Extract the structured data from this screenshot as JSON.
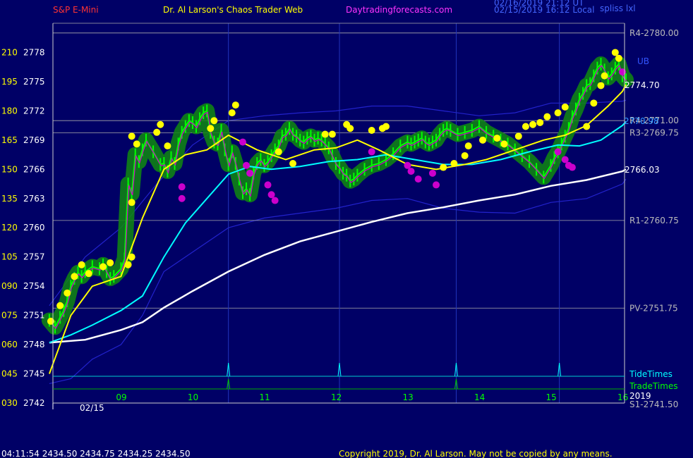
{
  "header": {
    "instrument": "S&P E-Mini",
    "site_title": "Dr. Al Larson's Chaos Trader Web",
    "site_url": "Daytradingforecasts.com",
    "timestamp_line1": "02/16/2019 21:12 UT",
    "timestamp_line2": "02/15/2019 16:12 Local",
    "corner_label": "spliss lxl"
  },
  "footer": {
    "last_bar": "04:11:54  2434.50  2434.75  2434.25  2434.50",
    "copyright": "Copyright 2019, Dr. Al Larson. May not be copied by any means."
  },
  "colors": {
    "background": "#000066",
    "price_line": "#00ff00",
    "short_average": "#ffff00",
    "mid_average": "#00ffff",
    "long_average": "#ffffff",
    "band": "#2222cc",
    "highs": "#ffff00",
    "lows": "#cc00cc",
    "level_lines": "#aaaaaa",
    "tide_times": "#00ffff",
    "trade_times": "#00cc00"
  },
  "chart_data": {
    "type": "line",
    "ylim": [
      2742,
      2781
    ],
    "xlim": [
      8.0,
      16.05
    ],
    "y_ticks": [
      {
        "price": 2778,
        "label": "210",
        "value": "2778"
      },
      {
        "price": 2775,
        "label": "195",
        "value": "2775"
      },
      {
        "price": 2772,
        "label": "180",
        "value": "2772"
      },
      {
        "price": 2769,
        "label": "165",
        "value": "2769"
      },
      {
        "price": 2766,
        "label": "150",
        "value": "2766"
      },
      {
        "price": 2763,
        "label": "135",
        "value": "2763"
      },
      {
        "price": 2760,
        "label": "120",
        "value": "2760"
      },
      {
        "price": 2757,
        "label": "105",
        "value": "2757"
      },
      {
        "price": 2754,
        "label": "090",
        "value": "2754"
      },
      {
        "price": 2751,
        "label": "075",
        "value": "2751"
      },
      {
        "price": 2748,
        "label": "060",
        "value": "2748"
      },
      {
        "price": 2745,
        "label": "045",
        "value": "2745"
      },
      {
        "price": 2742,
        "label": "030",
        "value": "2742"
      }
    ],
    "x_ticks": [
      {
        "hour": 9,
        "label": "09"
      },
      {
        "hour": 10,
        "label": "10"
      },
      {
        "hour": 11,
        "label": "11"
      },
      {
        "hour": 12,
        "label": "12"
      },
      {
        "hour": 13,
        "label": "13"
      },
      {
        "hour": 14,
        "label": "14"
      },
      {
        "hour": 15,
        "label": "15"
      },
      {
        "hour": 16,
        "label": "16"
      }
    ],
    "date_label": "02/15",
    "levels": [
      {
        "price": 2780.0,
        "label": "R4-2780.00"
      },
      {
        "price": 2771.0,
        "label": "R4-2771.00"
      },
      {
        "price": 2769.75,
        "label": "R3-2769.75"
      },
      {
        "price": 2760.75,
        "label": "R1-2760.75"
      },
      {
        "price": 2751.75,
        "label": "PV-2751.75"
      },
      {
        "price": 2741.5,
        "label": "S1-2741.50"
      }
    ],
    "level_extra_labels": [
      "UB",
      "2770.98"
    ],
    "value_labels": [
      {
        "price": 2774.7,
        "label": "2774.70"
      },
      {
        "price": 2766.03,
        "label": "2766.03"
      }
    ],
    "vertical_lines": [
      10.5,
      12.05,
      13.68,
      15.12
    ],
    "tide_times": [
      10.5,
      12.05,
      13.68,
      15.12
    ],
    "trade_times": [
      10.5,
      13.68
    ],
    "tide_label": "TideTimes",
    "trade_label": "TradeTimes",
    "year_label": "2019",
    "series": [
      {
        "role": "price",
        "x": [
          8.0,
          8.08,
          8.15,
          8.2,
          8.25,
          8.3,
          8.35,
          8.4,
          8.45,
          8.5,
          8.6,
          8.7,
          8.75,
          8.8,
          8.85,
          8.9,
          9.0,
          9.05,
          9.1,
          9.15,
          9.2,
          9.25,
          9.3,
          9.35,
          9.45,
          9.55,
          9.6,
          9.65,
          9.7,
          9.75,
          9.8,
          9.85,
          9.9,
          9.95,
          10.0,
          10.05,
          10.1,
          10.15,
          10.2,
          10.25,
          10.3,
          10.35,
          10.4,
          10.45,
          10.5,
          10.55,
          10.6,
          10.65,
          10.7,
          10.75,
          10.8,
          10.85,
          10.9,
          10.95,
          11.0,
          11.05,
          11.1,
          11.15,
          11.2,
          11.25,
          11.3,
          11.35,
          11.4,
          11.45,
          11.5,
          11.55,
          11.6,
          11.65,
          11.7,
          11.75,
          11.8,
          11.85,
          11.9,
          11.95,
          12.0,
          12.05,
          12.1,
          12.15,
          12.2,
          12.25,
          12.3,
          12.4,
          12.5,
          12.6,
          12.7,
          12.8,
          12.9,
          13.0,
          13.05,
          13.1,
          13.15,
          13.2,
          13.25,
          13.3,
          13.35,
          13.4,
          13.45,
          13.5,
          13.55,
          13.6,
          13.7,
          13.8,
          13.9,
          14.0,
          14.1,
          14.2,
          14.3,
          14.4,
          14.5,
          14.6,
          14.7,
          14.8,
          14.9,
          15.0,
          15.05,
          15.1,
          15.15,
          15.2,
          15.25,
          15.3,
          15.35,
          15.4,
          15.45,
          15.5,
          15.55,
          15.6,
          15.65,
          15.7,
          15.75,
          15.8,
          15.85,
          15.9,
          15.95,
          16.0,
          16.05
        ],
        "values": [
          2750.5,
          2749.8,
          2750.8,
          2751.5,
          2752.5,
          2754.0,
          2754.8,
          2755.4,
          2755.0,
          2755.5,
          2756.0,
          2755.8,
          2756.2,
          2755.5,
          2754.8,
          2755.0,
          2755.8,
          2756.8,
          2764.5,
          2763.5,
          2767.5,
          2766.8,
          2768.0,
          2769.0,
          2767.8,
          2766.5,
          2766.6,
          2765.8,
          2767.2,
          2766.6,
          2768.6,
          2769.8,
          2770.4,
          2771.0,
          2770.8,
          2770.4,
          2771.2,
          2771.8,
          2772.0,
          2769.8,
          2768.8,
          2768.6,
          2770.0,
          2768.0,
          2766.5,
          2767.8,
          2766.6,
          2765.0,
          2763.6,
          2764.0,
          2763.4,
          2765.6,
          2766.6,
          2767.0,
          2766.4,
          2766.8,
          2767.4,
          2768.0,
          2768.4,
          2769.4,
          2769.6,
          2770.2,
          2769.6,
          2769.4,
          2769.0,
          2768.8,
          2769.2,
          2769.4,
          2769.0,
          2769.2,
          2769.0,
          2768.6,
          2768.2,
          2767.4,
          2766.6,
          2766.2,
          2765.6,
          2765.4,
          2764.8,
          2765.0,
          2765.4,
          2766.0,
          2766.4,
          2766.6,
          2767.0,
          2767.6,
          2768.4,
          2768.8,
          2768.6,
          2768.8,
          2769.0,
          2769.2,
          2768.8,
          2768.6,
          2768.8,
          2769.0,
          2769.6,
          2770.0,
          2770.2,
          2770.0,
          2769.6,
          2769.8,
          2770.0,
          2770.4,
          2769.8,
          2769.4,
          2769.0,
          2768.6,
          2768.0,
          2767.4,
          2766.8,
          2766.0,
          2765.2,
          2766.4,
          2767.2,
          2767.8,
          2768.6,
          2769.4,
          2770.2,
          2771.4,
          2772.2,
          2773.2,
          2773.8,
          2774.6,
          2774.8,
          2775.6,
          2776.4,
          2776.8,
          2776.2,
          2775.4,
          2775.8,
          2776.4,
          2776.8,
          2775.6,
          2775.2
        ]
      },
      {
        "role": "short_average",
        "x": [
          8.0,
          8.3,
          8.6,
          9.0,
          9.3,
          9.6,
          9.9,
          10.2,
          10.5,
          10.9,
          11.3,
          11.7,
          12.0,
          12.3,
          12.6,
          13.0,
          13.4,
          13.8,
          14.1,
          14.5,
          14.9,
          15.2,
          15.5,
          15.8,
          16.0,
          16.05
        ],
        "values": [
          2745.0,
          2751.0,
          2754.0,
          2755.0,
          2761.0,
          2766.0,
          2767.5,
          2768.0,
          2769.5,
          2768.0,
          2767.0,
          2768.0,
          2768.2,
          2769.0,
          2768.0,
          2766.5,
          2766.0,
          2766.5,
          2767.0,
          2768.0,
          2769.0,
          2769.5,
          2770.5,
          2772.5,
          2774.0,
          2774.7
        ]
      },
      {
        "role": "mid_average",
        "x": [
          8.0,
          8.3,
          8.6,
          9.0,
          9.3,
          9.6,
          9.9,
          10.2,
          10.5,
          10.8,
          11.1,
          11.5,
          11.9,
          12.3,
          12.7,
          13.1,
          13.5,
          13.9,
          14.3,
          14.7,
          15.1,
          15.4,
          15.7,
          16.0,
          16.05
        ],
        "values": [
          2748.2,
          2749.0,
          2750.0,
          2751.5,
          2753.0,
          2757.0,
          2760.5,
          2763.0,
          2765.5,
          2766.3,
          2766.0,
          2766.3,
          2766.8,
          2767.0,
          2767.5,
          2767.0,
          2766.5,
          2766.5,
          2767.0,
          2767.8,
          2768.5,
          2768.4,
          2769.0,
          2770.5,
          2770.9
        ]
      },
      {
        "role": "long_average",
        "x": [
          8.0,
          8.5,
          9.0,
          9.3,
          9.6,
          10.0,
          10.5,
          11.0,
          11.5,
          12.0,
          12.5,
          13.0,
          13.5,
          14.0,
          14.5,
          15.0,
          15.5,
          16.0,
          16.05
        ],
        "values": [
          2748.2,
          2748.5,
          2749.5,
          2750.3,
          2751.8,
          2753.5,
          2755.5,
          2757.2,
          2758.6,
          2759.6,
          2760.6,
          2761.5,
          2762.1,
          2762.8,
          2763.4,
          2764.3,
          2764.9,
          2765.8,
          2766.0
        ]
      },
      {
        "role": "upper_band",
        "x": [
          8.0,
          8.5,
          9.0,
          9.5,
          10.0,
          10.5,
          11.0,
          11.5,
          12.0,
          12.5,
          13.0,
          13.5,
          14.0,
          14.5,
          15.0,
          15.5,
          16.0,
          16.05
        ],
        "values": [
          2752.0,
          2757.0,
          2760.0,
          2764.5,
          2768.5,
          2771.0,
          2771.5,
          2771.8,
          2772.0,
          2772.5,
          2772.5,
          2772.0,
          2771.5,
          2771.8,
          2772.8,
          2772.8,
          2773.0,
          2773.1
        ]
      },
      {
        "role": "lower_band",
        "x": [
          8.0,
          8.3,
          8.6,
          9.0,
          9.3,
          9.6,
          10.0,
          10.5,
          11.0,
          11.5,
          12.0,
          12.5,
          13.0,
          13.5,
          14.0,
          14.5,
          15.0,
          15.5,
          16.0,
          16.05
        ],
        "values": [
          2744.0,
          2744.5,
          2746.5,
          2748.0,
          2751.0,
          2755.5,
          2757.5,
          2760.0,
          2761.0,
          2761.5,
          2762.0,
          2762.8,
          2763.0,
          2762.0,
          2761.6,
          2761.5,
          2762.6,
          2763.0,
          2764.5,
          2765.0
        ]
      }
    ],
    "highs": [
      {
        "x": 8.02,
        "price": 2750.4
      },
      {
        "x": 8.15,
        "price": 2752.0
      },
      {
        "x": 8.25,
        "price": 2753.3
      },
      {
        "x": 8.35,
        "price": 2755.0
      },
      {
        "x": 8.45,
        "price": 2756.2
      },
      {
        "x": 8.55,
        "price": 2755.3
      },
      {
        "x": 8.75,
        "price": 2756.0
      },
      {
        "x": 8.85,
        "price": 2756.4
      },
      {
        "x": 9.1,
        "price": 2756.2
      },
      {
        "x": 9.15,
        "price": 2769.4
      },
      {
        "x": 9.22,
        "price": 2768.6
      },
      {
        "x": 9.15,
        "price": 2762.6
      },
      {
        "x": 9.15,
        "price": 2757.0
      },
      {
        "x": 9.5,
        "price": 2769.8
      },
      {
        "x": 9.55,
        "price": 2770.6
      },
      {
        "x": 9.65,
        "price": 2768.4
      },
      {
        "x": 10.25,
        "price": 2770.2
      },
      {
        "x": 10.3,
        "price": 2771.0
      },
      {
        "x": 10.6,
        "price": 2772.6
      },
      {
        "x": 10.55,
        "price": 2771.8
      },
      {
        "x": 11.2,
        "price": 2767.8
      },
      {
        "x": 11.4,
        "price": 2766.6
      },
      {
        "x": 11.85,
        "price": 2769.6
      },
      {
        "x": 11.95,
        "price": 2769.6
      },
      {
        "x": 12.15,
        "price": 2770.6
      },
      {
        "x": 12.2,
        "price": 2770.2
      },
      {
        "x": 12.5,
        "price": 2770.0
      },
      {
        "x": 12.65,
        "price": 2770.2
      },
      {
        "x": 12.7,
        "price": 2770.4
      },
      {
        "x": 13.5,
        "price": 2766.2
      },
      {
        "x": 13.65,
        "price": 2766.6
      },
      {
        "x": 13.8,
        "price": 2767.4
      },
      {
        "x": 13.85,
        "price": 2768.4
      },
      {
        "x": 14.05,
        "price": 2769.0
      },
      {
        "x": 14.25,
        "price": 2769.2
      },
      {
        "x": 14.35,
        "price": 2768.6
      },
      {
        "x": 14.55,
        "price": 2769.4
      },
      {
        "x": 14.65,
        "price": 2770.4
      },
      {
        "x": 14.75,
        "price": 2770.6
      },
      {
        "x": 14.85,
        "price": 2770.8
      },
      {
        "x": 14.95,
        "price": 2771.4
      },
      {
        "x": 15.1,
        "price": 2771.8
      },
      {
        "x": 15.2,
        "price": 2772.4
      },
      {
        "x": 15.5,
        "price": 2770.4
      },
      {
        "x": 15.6,
        "price": 2772.8
      },
      {
        "x": 15.7,
        "price": 2774.6
      },
      {
        "x": 15.75,
        "price": 2775.6
      },
      {
        "x": 15.9,
        "price": 2778.0
      },
      {
        "x": 15.95,
        "price": 2777.4
      }
    ],
    "lows": [
      {
        "x": 9.85,
        "price": 2764.2
      },
      {
        "x": 9.85,
        "price": 2763.0
      },
      {
        "x": 10.7,
        "price": 2768.8
      },
      {
        "x": 10.75,
        "price": 2766.4
      },
      {
        "x": 10.8,
        "price": 2765.6
      },
      {
        "x": 11.05,
        "price": 2764.4
      },
      {
        "x": 11.1,
        "price": 2763.4
      },
      {
        "x": 11.15,
        "price": 2762.8
      },
      {
        "x": 12.5,
        "price": 2767.8
      },
      {
        "x": 13.0,
        "price": 2766.4
      },
      {
        "x": 13.05,
        "price": 2765.8
      },
      {
        "x": 13.15,
        "price": 2765.0
      },
      {
        "x": 13.35,
        "price": 2765.6
      },
      {
        "x": 13.4,
        "price": 2764.4
      },
      {
        "x": 15.1,
        "price": 2767.8
      },
      {
        "x": 15.2,
        "price": 2767.0
      },
      {
        "x": 15.25,
        "price": 2766.4
      },
      {
        "x": 15.3,
        "price": 2766.2
      },
      {
        "x": 16.0,
        "price": 2776.0
      }
    ],
    "grid": false
  }
}
